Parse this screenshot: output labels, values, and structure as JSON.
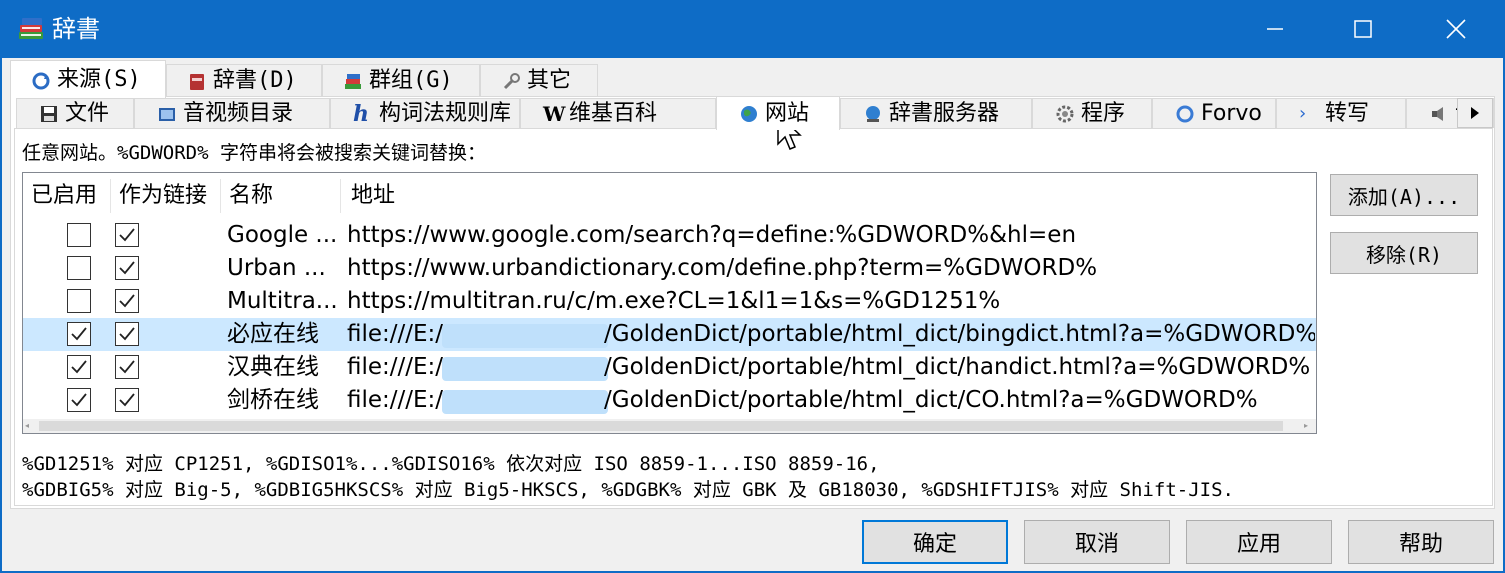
{
  "window": {
    "title": "辞書",
    "minimize": "—",
    "maximize": "☐",
    "close": "✕"
  },
  "outer_tabs": [
    {
      "label": "来源(S)",
      "icon": "sources-icon"
    },
    {
      "label": "辞書(D)",
      "icon": "dictionary-book-icon"
    },
    {
      "label": "群组(G)",
      "icon": "books-group-icon"
    },
    {
      "label": "其它",
      "icon": "wrench-icon"
    }
  ],
  "inner_tabs": [
    {
      "label": "文件",
      "icon": "floppy-icon"
    },
    {
      "label": "音视频目录",
      "icon": "media-folder-icon"
    },
    {
      "label": "构词法规则库",
      "icon": "hunspell-h-icon"
    },
    {
      "label": "维基百科",
      "icon": "wikipedia-w-icon"
    },
    {
      "label": "网站",
      "icon": "globe-icon"
    },
    {
      "label": "辞書服务器",
      "icon": "server-globe-icon"
    },
    {
      "label": "程序",
      "icon": "gear-icon"
    },
    {
      "label": "Forvo",
      "icon": "forvo-ring-icon"
    },
    {
      "label": "转写",
      "icon": "chevron-right-icon"
    },
    {
      "label": "语音",
      "icon": "speaker-icon"
    }
  ],
  "description": "任意网站。%GDWORD% 字符串将会被搜索关键词替换：",
  "table": {
    "headers": [
      "已启用",
      "作为链接",
      "名称",
      "地址"
    ],
    "rows": [
      {
        "enabled": false,
        "as_link": true,
        "name": "Google ...",
        "address": "https://www.google.com/search?q=define:%GDWORD%&hl=en",
        "selected": false,
        "redacted": false
      },
      {
        "enabled": false,
        "as_link": true,
        "name": "Urban ...",
        "address": "https://www.urbandictionary.com/define.php?term=%GDWORD%",
        "selected": false,
        "redacted": false
      },
      {
        "enabled": false,
        "as_link": true,
        "name": "Multitra...",
        "address": "https://multitran.ru/c/m.exe?CL=1&l1=1&s=%GD1251%",
        "selected": false,
        "redacted": false
      },
      {
        "enabled": true,
        "as_link": true,
        "name": "必应在线",
        "address_prefix": "file:///E:/",
        "address": "/GoldenDict/portable/html_dict/bingdict.html?a=%GDWORD%",
        "selected": true,
        "redacted": true
      },
      {
        "enabled": true,
        "as_link": true,
        "name": "汉典在线",
        "address_prefix": "file:///E:/",
        "address": "/GoldenDict/portable/html_dict/handict.html?a=%GDWORD%",
        "selected": false,
        "redacted": true
      },
      {
        "enabled": true,
        "as_link": true,
        "name": "剑桥在线",
        "address_prefix": "file:///E:/",
        "address": "/GoldenDict/portable/html_dict/CO.html?a=%GDWORD%",
        "selected": false,
        "redacted": true
      }
    ]
  },
  "side_buttons": {
    "add": "添加(A)...",
    "remove": "移除(R)"
  },
  "footnote": {
    "line1": "%GD1251% 对应 CP1251, %GDISO1%...%GDISO16% 依次对应 ISO 8859-1...ISO 8859-16,",
    "line2": "%GDBIG5% 对应 Big-5, %GDBIG5HKSCS% 对应 Big5-HKSCS, %GDGBK% 对应 GBK 及 GB18030, %GDSHIFTJIS% 对应 Shift-JIS."
  },
  "dialog_buttons": {
    "ok": "确定",
    "cancel": "取消",
    "apply": "应用",
    "help": "帮助"
  },
  "colors": {
    "titlebar": "#0e6cc6",
    "selection": "#cce8ff",
    "default_button_border": "#0078d7"
  }
}
